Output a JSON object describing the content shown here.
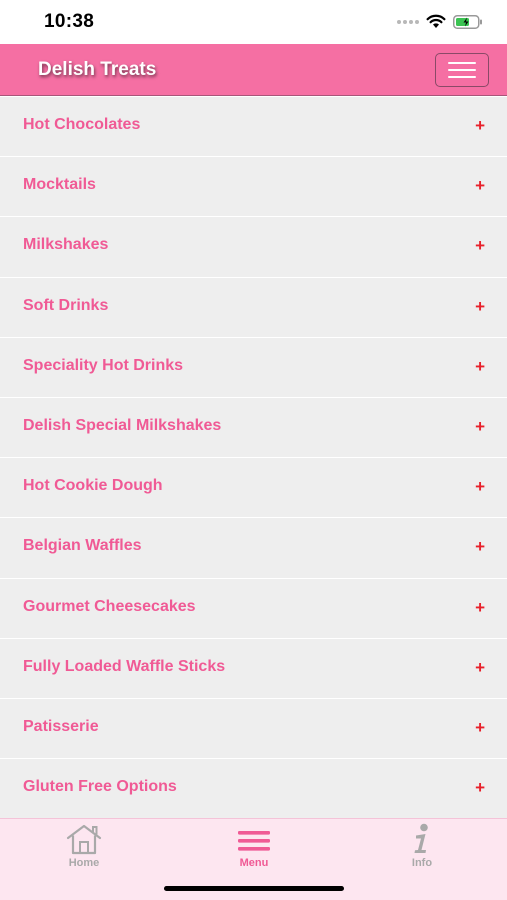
{
  "status_bar": {
    "time": "10:38"
  },
  "header": {
    "title": "Delish Treats"
  },
  "menu": {
    "items": [
      {
        "label": "Hot Chocolates",
        "expand": "+"
      },
      {
        "label": "Mocktails",
        "expand": "+"
      },
      {
        "label": "Milkshakes",
        "expand": "+"
      },
      {
        "label": "Soft Drinks",
        "expand": "+"
      },
      {
        "label": "Speciality Hot Drinks",
        "expand": "+"
      },
      {
        "label": "Delish Special Milkshakes",
        "expand": "+"
      },
      {
        "label": "Hot Cookie Dough",
        "expand": "+"
      },
      {
        "label": "Belgian Waffles",
        "expand": "+"
      },
      {
        "label": "Gourmet Cheesecakes",
        "expand": "+"
      },
      {
        "label": "Fully Loaded Waffle Sticks",
        "expand": "+"
      },
      {
        "label": "Patisserie",
        "expand": "+"
      },
      {
        "label": "Gluten Free Options",
        "expand": "+"
      }
    ]
  },
  "tabs": {
    "home": {
      "label": "Home",
      "icon": "home-icon"
    },
    "menu": {
      "label": "Menu",
      "icon": "menu-icon"
    },
    "info": {
      "label": "Info",
      "icon": "info-icon"
    }
  },
  "colors": {
    "brand_pink": "#f56fa3",
    "item_text": "#f05a95",
    "plus": "#e8202a",
    "tab_bg": "#fde6f0"
  }
}
